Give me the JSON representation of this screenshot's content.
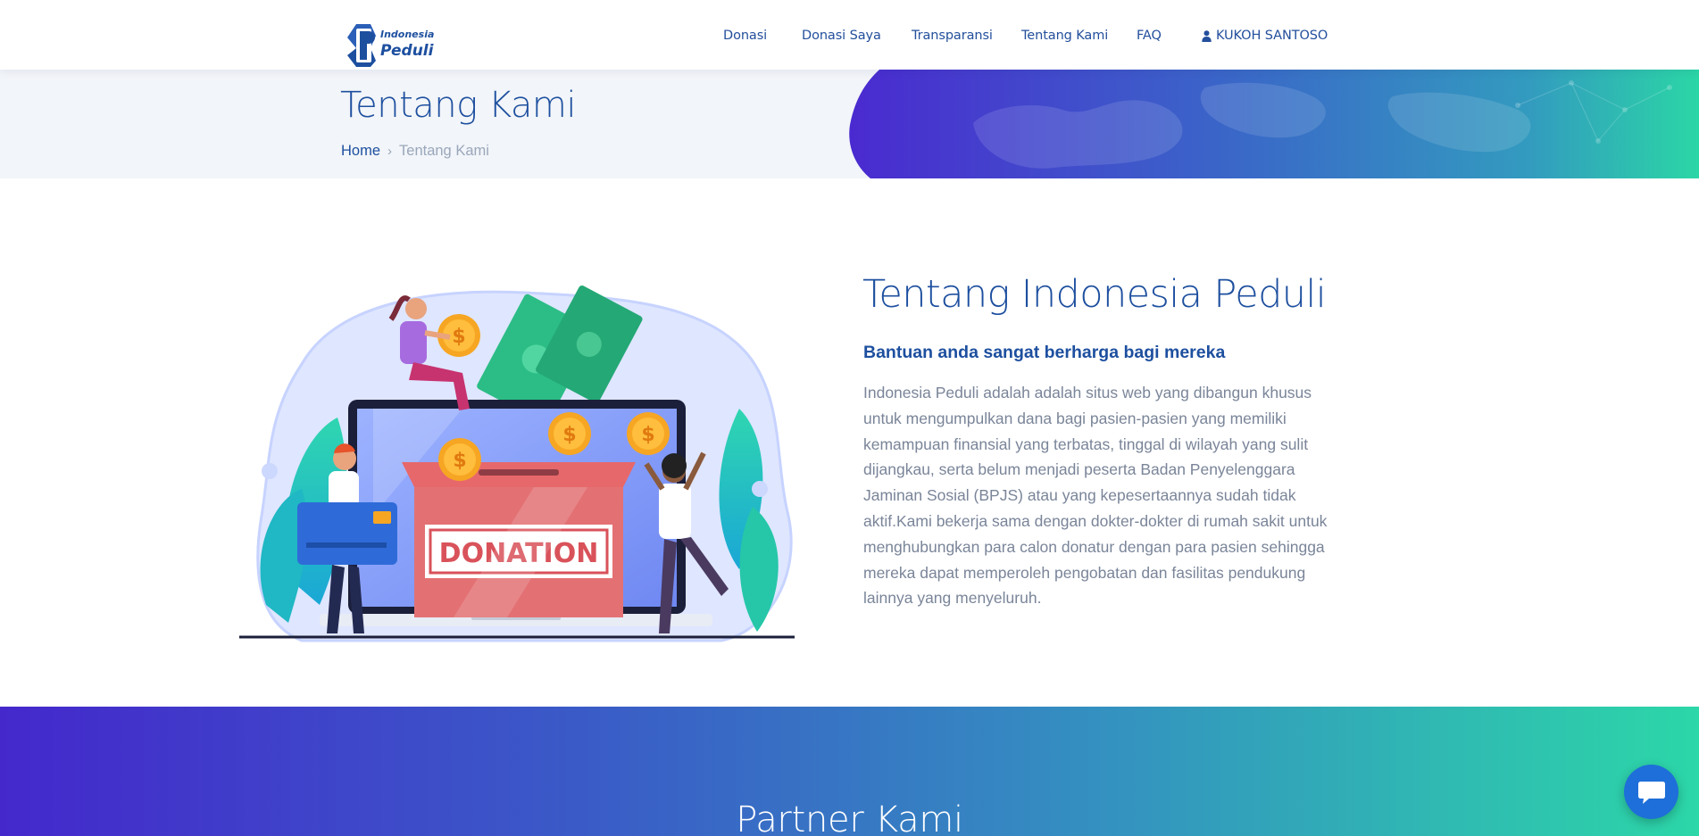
{
  "brand": {
    "logo_line1": "Indonesia",
    "logo_line2": "Peduli",
    "primary_color": "#1d4f9f",
    "gradient_start": "#4428cc",
    "gradient_end": "#2cd7a8"
  },
  "nav": {
    "items": [
      {
        "label": "Donasi"
      },
      {
        "label": "Donasi Saya"
      },
      {
        "label": "Transparansi"
      },
      {
        "label": "Tentang Kami"
      },
      {
        "label": "FAQ"
      }
    ],
    "user": {
      "icon": "user-icon",
      "label": "KUKOH SANTOSO"
    }
  },
  "hero": {
    "title": "Tentang Kami",
    "breadcrumb": {
      "home": "Home",
      "separator": "›",
      "current": "Tentang Kami"
    }
  },
  "about": {
    "illustration_label": "DONATION",
    "title": "Tentang Indonesia Peduli",
    "subtitle": "Bantuan anda sangat berharga bagi mereka",
    "body": "Indonesia Peduli adalah adalah situs web yang dibangun khusus untuk mengumpulkan dana bagi pasien-pasien yang memiliki kemampuan finansial yang terbatas, tinggal di wilayah yang sulit dijangkau, serta belum menjadi peserta Badan Penyelenggara Jaminan Sosial (BPJS) atau yang kepesertaannya sudah tidak aktif.Kami bekerja sama dengan dokter-dokter di rumah sakit untuk menghubungkan para calon donatur dengan para pasien sehingga mereka dapat memperoleh pengobatan dan fasilitas pendukung lainnya yang menyeluruh."
  },
  "partner": {
    "title": "Partner Kami"
  },
  "chat": {
    "icon": "chat-bubble-icon"
  }
}
